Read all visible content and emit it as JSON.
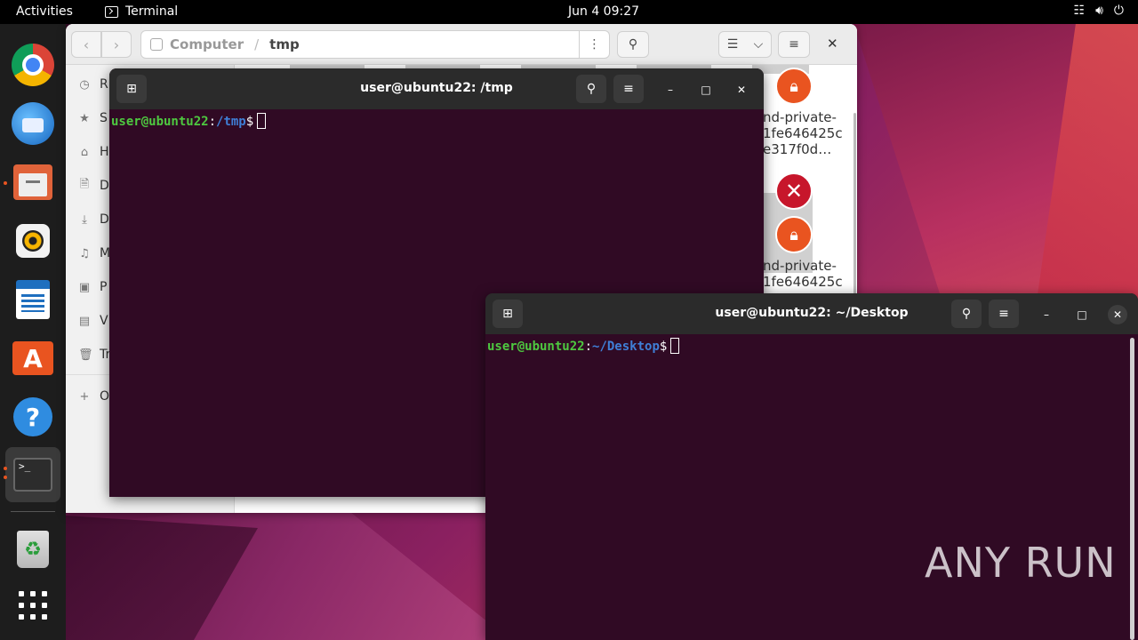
{
  "topbar": {
    "activities": "Activities",
    "app_name": "Terminal",
    "clock": "Jun 4  09:27"
  },
  "dock": {
    "items": [
      "google-chrome",
      "thunderbird",
      "files",
      "rhythmbox",
      "libreoffice-writer",
      "ubuntu-software",
      "help",
      "terminal",
      "trash",
      "show-applications"
    ]
  },
  "files_window": {
    "path": [
      "Computer",
      "tmp"
    ],
    "sidebar": [
      {
        "icon": "recent-icon",
        "label": "R"
      },
      {
        "icon": "star-icon",
        "label": "S"
      },
      {
        "icon": "home-icon",
        "label": "H"
      },
      {
        "icon": "document-icon",
        "label": "D"
      },
      {
        "icon": "download-icon",
        "label": "D"
      },
      {
        "icon": "music-icon",
        "label": "M"
      },
      {
        "icon": "pictures-icon",
        "label": "P"
      },
      {
        "icon": "videos-icon",
        "label": "V"
      },
      {
        "icon": "trash-icon",
        "label": "Tr"
      },
      {
        "icon": "plus-icon",
        "label": "O"
      }
    ],
    "files": [
      {
        "name_lines": [
          "nd-private-",
          "1fe646425c",
          "e317f0d…"
        ],
        "badge": "lock"
      },
      {
        "name_lines": [
          "nd-private-",
          "1fe646425c"
        ],
        "badge": "lock"
      }
    ]
  },
  "terminal_tmp": {
    "title": "user@ubuntu22: /tmp",
    "prompt_user": "user@ubuntu22",
    "prompt_sep": ":",
    "prompt_path": "/tmp",
    "prompt_end": "$"
  },
  "terminal_desktop": {
    "title": "user@ubuntu22: ~/Desktop",
    "prompt_user": "user@ubuntu22",
    "prompt_sep": ":",
    "prompt_path": "~/Desktop",
    "prompt_end": "$"
  },
  "watermark": "ANY RUN"
}
